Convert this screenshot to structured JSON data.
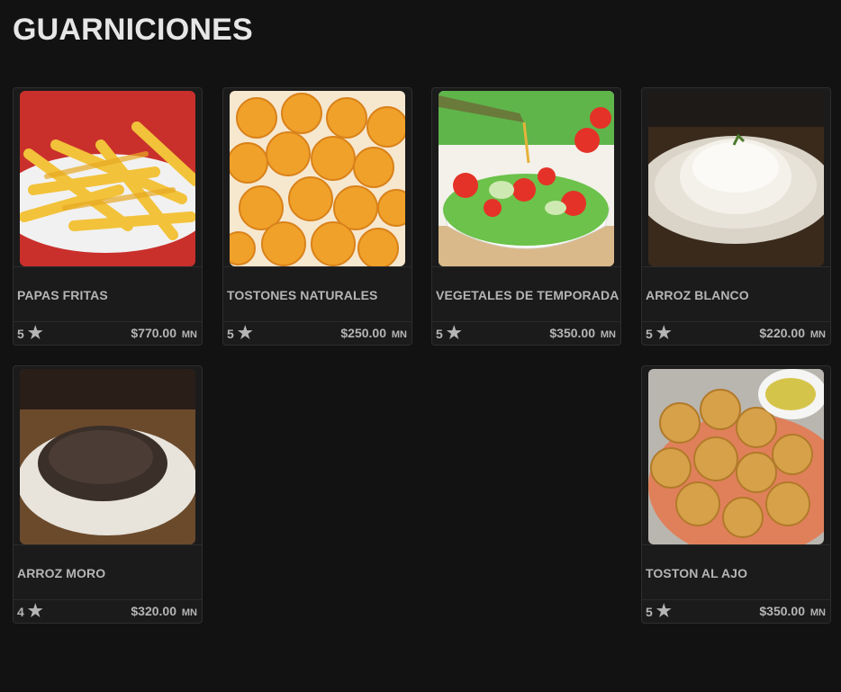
{
  "section_title": "GUARNICIONES",
  "products": [
    {
      "name": "PAPAS FRITAS",
      "rating": "5",
      "price": "$770.00",
      "currency": "MN",
      "image_desc": "french-fries-photo"
    },
    {
      "name": "TOSTONES NATURALES",
      "rating": "5",
      "price": "$250.00",
      "currency": "MN",
      "image_desc": "tostones-photo"
    },
    {
      "name": "VEGETALES DE TEMPORADA",
      "rating": "5",
      "price": "$350.00",
      "currency": "MN",
      "image_desc": "salad-photo"
    },
    {
      "name": "ARROZ BLANCO",
      "rating": "5",
      "price": "$220.00",
      "currency": "MN",
      "image_desc": "white-rice-photo"
    },
    {
      "name": "ARROZ MORO",
      "rating": "4",
      "price": "$320.00",
      "currency": "MN",
      "image_desc": "congri-rice-photo"
    },
    {
      "name": "TOSTON AL AJO",
      "rating": "5",
      "price": "$350.00",
      "currency": "MN",
      "image_desc": "garlic-tostones-photo"
    }
  ],
  "star_icon": "star-icon",
  "colors": {
    "background": "#121212",
    "card": "#1b1b1b",
    "text": "#b5b5b5",
    "title": "#e6e6e6"
  }
}
